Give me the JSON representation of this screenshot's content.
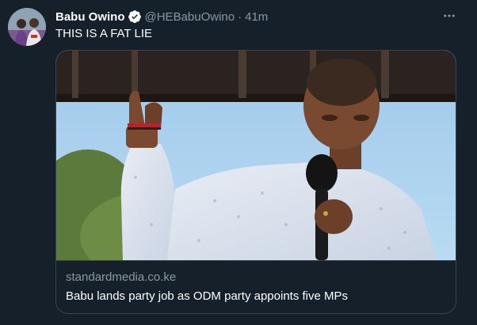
{
  "tweet": {
    "author_name": "Babu Owino",
    "author_handle": "@HEBabuOwino",
    "separator": "·",
    "time": "41m",
    "text": "THIS IS A FAT LIE",
    "verified": true,
    "more_icon": "more-horizontal-icon"
  },
  "card": {
    "domain": "standardmedia.co.ke",
    "title": "Babu lands party job as ODM party appoints five MPs",
    "image_alt": "Man in a white patterned shirt speaking into a microphone with his index finger raised"
  },
  "colors": {
    "background": "#15202b",
    "primary_text": "#ffffff",
    "secondary_text": "#8899a6",
    "border": "#38444d",
    "verified_blue": "#1d9bf0"
  }
}
